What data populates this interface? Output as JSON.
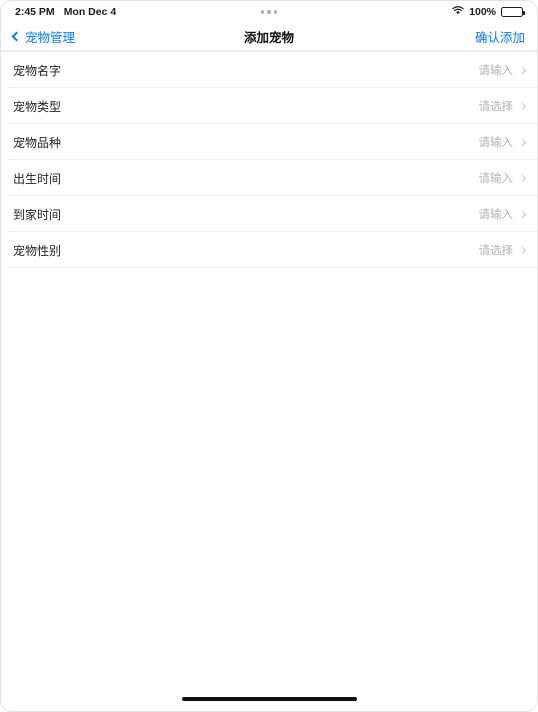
{
  "status_bar": {
    "time": "2:45 PM",
    "date": "Mon Dec 4",
    "wifi_icon": "wifi-icon",
    "battery_percent": "100%",
    "battery_icon": "battery-full-icon",
    "multitask_icon": "multitasking-dots-icon"
  },
  "nav_bar": {
    "back_icon": "chevron-left-icon",
    "back_label": "宠物管理",
    "title": "添加宠物",
    "action_label": "确认添加"
  },
  "form": {
    "rows": [
      {
        "label": "宠物名字",
        "value": "请输入",
        "accessory_icon": "chevron-right-icon"
      },
      {
        "label": "宠物类型",
        "value": "请选择",
        "accessory_icon": "chevron-right-icon"
      },
      {
        "label": "宠物品种",
        "value": "请输入",
        "accessory_icon": "chevron-right-icon"
      },
      {
        "label": "出生时间",
        "value": "请输入",
        "accessory_icon": "chevron-right-icon"
      },
      {
        "label": "到家时间",
        "value": "请输入",
        "accessory_icon": "chevron-right-icon"
      },
      {
        "label": "宠物性别",
        "value": "请选择",
        "accessory_icon": "chevron-right-icon"
      }
    ]
  },
  "home_indicator": {
    "name": "home-indicator"
  },
  "colors": {
    "accent": "#0a7cff",
    "label_text": "#23232a",
    "placeholder_text": "#b4b4b9",
    "separator": "#ececee",
    "background": "#ffffff"
  }
}
